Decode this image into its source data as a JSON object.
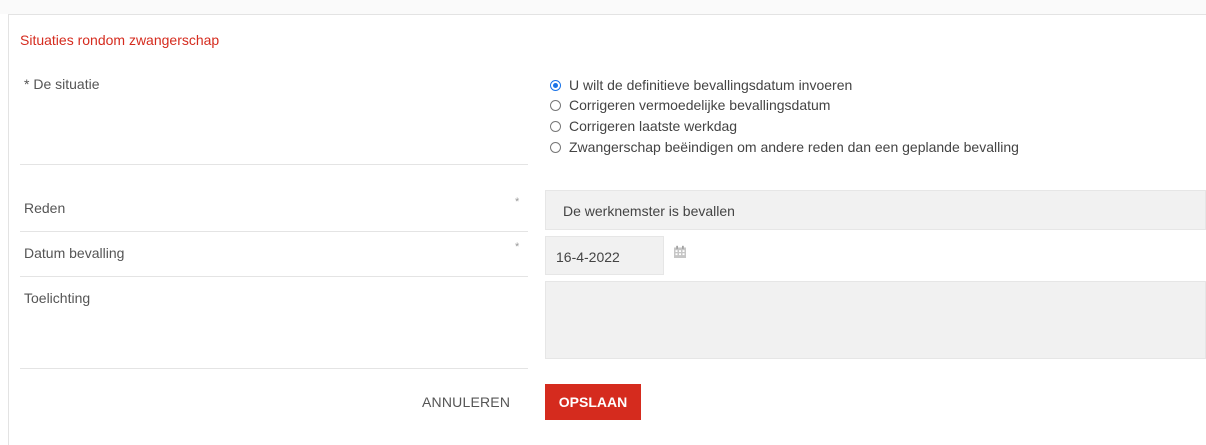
{
  "section": {
    "title": "Situaties rondom zwangerschap"
  },
  "situation": {
    "label": "* De situatie",
    "options": [
      {
        "label": "U wilt de definitieve bevallingsdatum invoeren",
        "checked": true
      },
      {
        "label": "Corrigeren vermoedelijke bevallingsdatum",
        "checked": false
      },
      {
        "label": "Corrigeren laatste werkdag",
        "checked": false
      },
      {
        "label": "Zwangerschap beëindigen om andere reden dan een geplande bevalling",
        "checked": false
      }
    ]
  },
  "reason": {
    "label": "Reden",
    "required_marker": "*",
    "value": "De werknemster is bevallen"
  },
  "birth_date": {
    "label": "Datum bevalling",
    "required_marker": "*",
    "value": "16-4-2022",
    "icon": "calendar-icon"
  },
  "explanation": {
    "label": "Toelichting",
    "value": ""
  },
  "actions": {
    "cancel_label": "ANNULEREN",
    "save_label": "OPSLAAN"
  },
  "colors": {
    "accent": "#d52b1e",
    "radio": "#1a73e8",
    "field_bg": "#f1f1f1"
  }
}
